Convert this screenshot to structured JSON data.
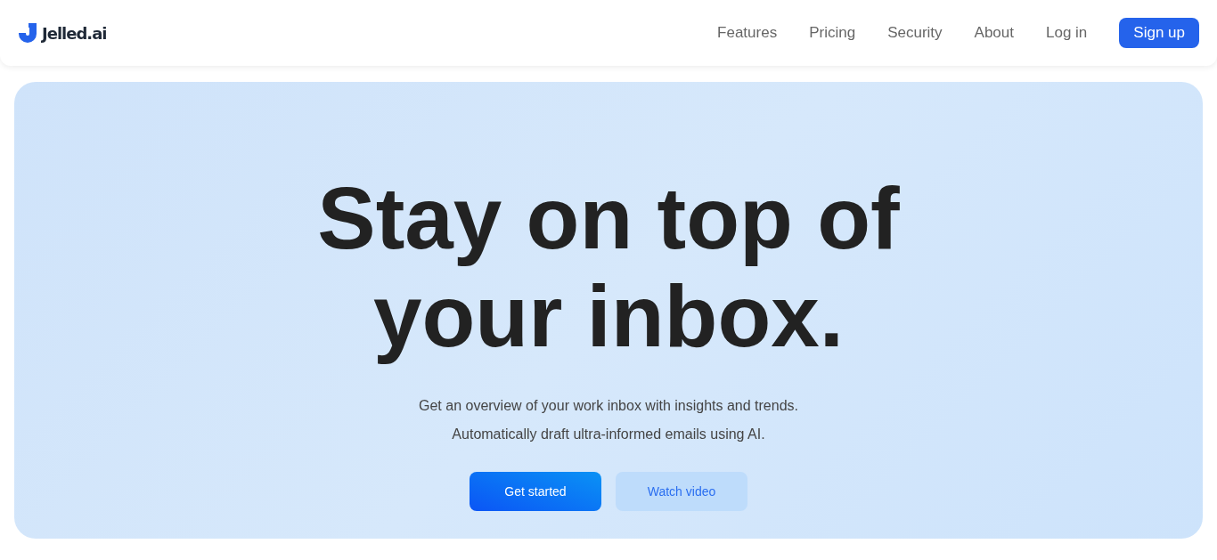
{
  "brand": {
    "name": "Jelled.ai"
  },
  "nav": {
    "links": [
      "Features",
      "Pricing",
      "Security",
      "About",
      "Log in"
    ],
    "signup": "Sign up"
  },
  "hero": {
    "headline": "Stay on top of your inbox.",
    "lines": [
      "Get an overview of your work inbox with insights and trends.",
      "Automatically draft ultra-informed emails using AI."
    ],
    "buttons": [
      {
        "label": "Get started",
        "kind": "primary"
      },
      {
        "label": "Watch video",
        "kind": "secondary"
      }
    ]
  }
}
